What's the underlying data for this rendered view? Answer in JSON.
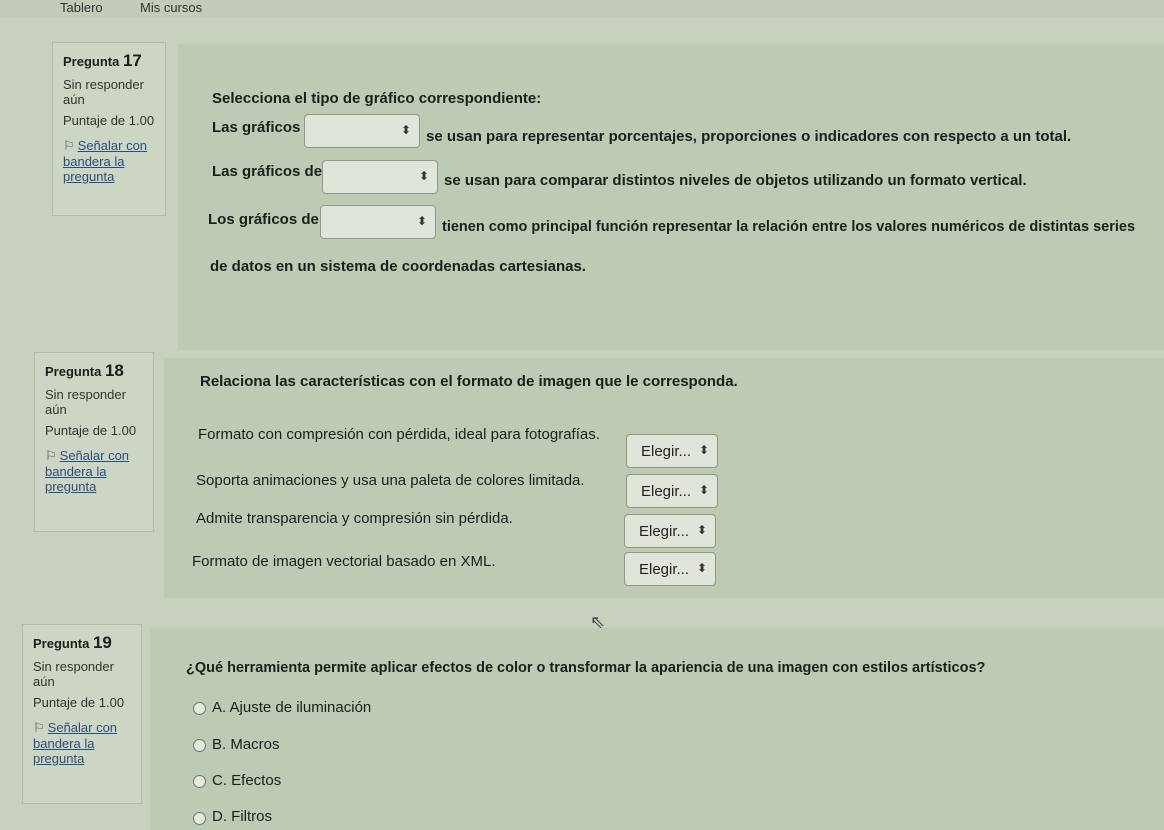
{
  "nav": {
    "item1": "Tablero",
    "item2": "Mis cursos"
  },
  "status": {
    "unanswered_line1": "Sin responder",
    "unanswered_line2": "aún",
    "score": "Puntaje de 1.00",
    "flag_line1": "Señalar con",
    "flag_line2": "bandera la",
    "flag_line3": "pregunta"
  },
  "q17": {
    "label": "Pregunta",
    "number": "17",
    "instruction": "Selecciona el tipo de gráfico correspondiente:",
    "r1_pre": "Las gráficos",
    "r1_post": "se usan para representar porcentajes, proporciones o indicadores con respecto a un total.",
    "r2_pre": "Las gráficos de",
    "r2_post": "se usan para comparar distintos niveles de objetos utilizando un formato vertical.",
    "r3_pre": "Los gráficos de",
    "r3_post": "tienen como principal función representar la relación entre los valores numéricos de distintas series",
    "r3_cont": "de datos en un sistema de coordenadas cartesianas."
  },
  "q18": {
    "label": "Pregunta",
    "number": "18",
    "instruction": "Relaciona las características con el formato de imagen que le corresponda.",
    "items": [
      "Formato con compresión con pérdida, ideal para fotografías.",
      "Soporta animaciones y usa una paleta de colores limitada.",
      "Admite transparencia y compresión sin pérdida.",
      "Formato de imagen vectorial basado en XML."
    ],
    "select_placeholder": "Elegir..."
  },
  "q19": {
    "label": "Pregunta",
    "number": "19",
    "question": "¿Qué herramienta permite aplicar efectos de color o transformar la apariencia de una imagen con estilos artísticos?",
    "options": [
      "A.  Ajuste de iluminación",
      "B.  Macros",
      "C.  Efectos",
      "D.  Filtros"
    ]
  }
}
